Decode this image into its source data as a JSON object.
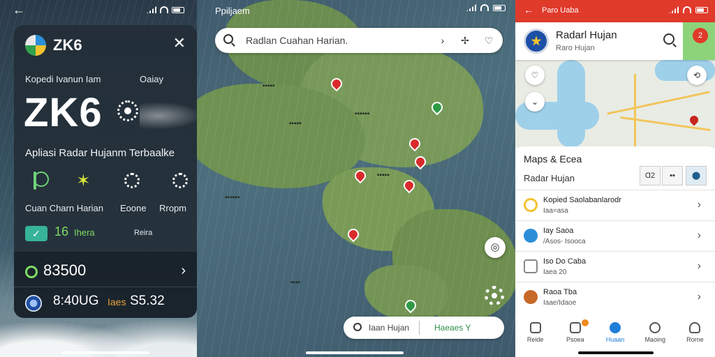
{
  "left": {
    "card": {
      "code": "ZK6",
      "label_left": "Kopedi Ivanun Iam",
      "label_right": "Oaiay",
      "big_code": "ZK6",
      "tagline": "Apliasi Radar Hujanm Terbaalke",
      "icon_labels": [
        "Cuan Charn Harian",
        "Eoone",
        "Rropm"
      ],
      "badge_value": "16",
      "badge_unit": "Ihera",
      "badge_right": "Reira",
      "row1_value": "83500",
      "row2_value": "8:40UG",
      "row2_sub": "Iaes",
      "row2_extra": "S5.32"
    }
  },
  "middle": {
    "title": "Ppiljaem",
    "search_placeholder": "Radlan Cuahan Harian.",
    "bottom_search": "Iaan Hujan",
    "bottom_right": "Haeaes Y"
  },
  "right": {
    "status_title": "Paro Uaba",
    "app_name": "Radarl Hujan",
    "app_sub": "Raro Hujan",
    "notif_count": "2",
    "sheet_title": "Maps & Ecea",
    "sheet_sub": "Radar Hujan",
    "segments": [
      "Ɑ2",
      "▪▪",
      "⬤"
    ],
    "list": [
      {
        "t1": "Kopied Saolabanlarodr",
        "t2": "Iaa=asa",
        "icon_color": "#f2c230"
      },
      {
        "t1": "Iay Saoa",
        "t2": "/Asos- Isooca",
        "icon_color": "#2b8fd8"
      },
      {
        "t1": "Iso Do Caba",
        "t2": "Iaea 20",
        "icon_color": "#888888"
      },
      {
        "t1": "Raoa Tba",
        "t2": "Iaae/Idaoe",
        "icon_color": "#c76a2a"
      }
    ],
    "tabs": [
      "Reide",
      "Psoea",
      "Huaan",
      "Maoing",
      "Rorne"
    ]
  }
}
